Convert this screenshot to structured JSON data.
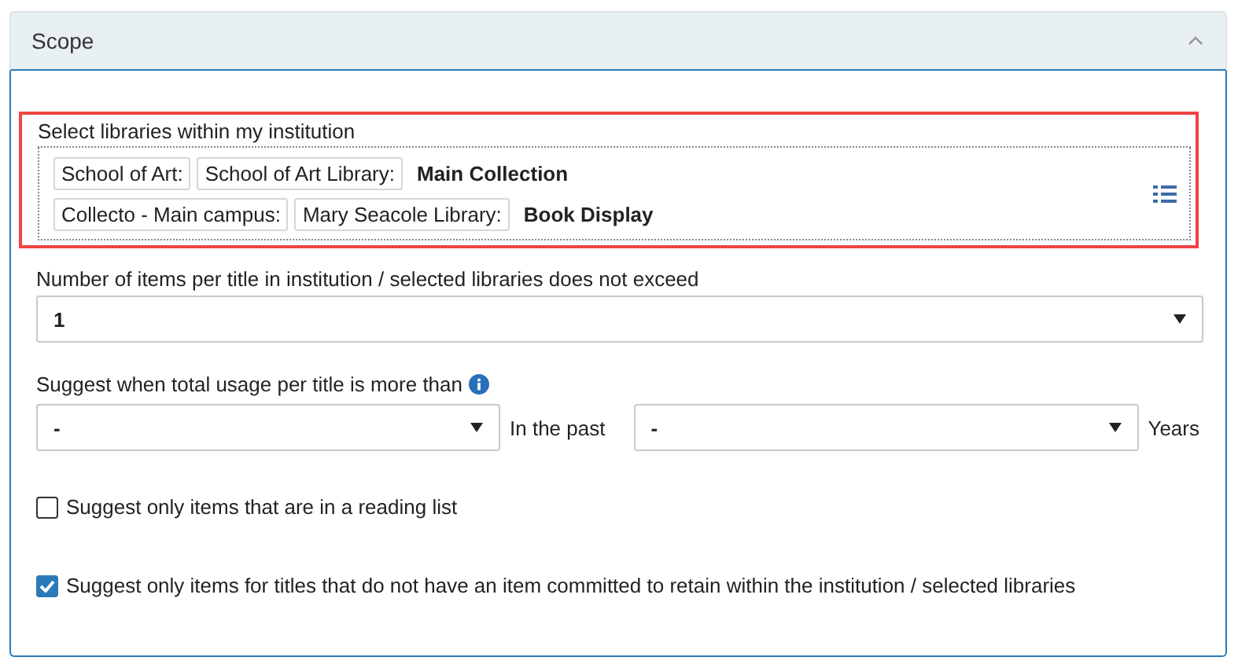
{
  "panel": {
    "title": "Scope",
    "expanded": true
  },
  "libraries": {
    "label": "Select libraries within my institution",
    "highlighted": true,
    "rows": [
      {
        "tags": [
          "School of Art:",
          "School of Art Library:"
        ],
        "location": "Main Collection"
      },
      {
        "tags": [
          "Collecto - Main campus:",
          "Mary Seacole Library:"
        ],
        "location": "Book Display"
      }
    ]
  },
  "items_limit": {
    "label": "Number of items per title in institution / selected libraries does not exceed",
    "value": "1"
  },
  "usage": {
    "label": "Suggest when total usage per title is more than",
    "value": "-",
    "past_label": "In the past",
    "past_value": "-",
    "unit": "Years"
  },
  "checks": [
    {
      "label": "Suggest only items that are in a reading list",
      "checked": false
    },
    {
      "label": "Suggest only items for titles that do not have an item committed to retain within the institution / selected libraries",
      "checked": true
    }
  ]
}
